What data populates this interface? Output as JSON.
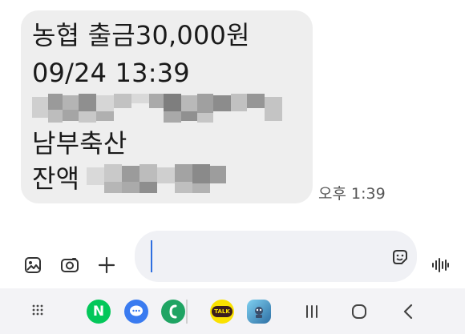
{
  "message": {
    "line1": "농협 출금30,000원",
    "line2": "09/24 13:39",
    "line4": "남부축산",
    "line5_prefix": "잔액",
    "time": "오후 1:39"
  },
  "composer": {
    "gallery_icon": "gallery-icon",
    "camera_icon": "camera-icon",
    "add_icon": "plus-icon",
    "emoji_icon": "emoji-sticker-icon",
    "voice_icon": "voice-waveform-icon",
    "input_value": ""
  },
  "navbar": {
    "apps": [
      {
        "name": "naver",
        "label": "N",
        "color": "#03c75a"
      },
      {
        "name": "messages",
        "label": "",
        "color": "#3a7bf0"
      },
      {
        "name": "phone",
        "label": "",
        "color": "#1fa463"
      },
      {
        "name": "kakaotalk",
        "label": "TALK",
        "color": "#fae100"
      },
      {
        "name": "game",
        "label": "",
        "color": "#2d8fc4"
      }
    ],
    "icons": [
      "app-drawer-icon",
      "recent-apps-icon",
      "home-icon",
      "back-icon"
    ]
  },
  "colors": {
    "bubble": "#eeeeee",
    "accent": "#2f6fe0",
    "navbar": "#f3f3f6"
  }
}
